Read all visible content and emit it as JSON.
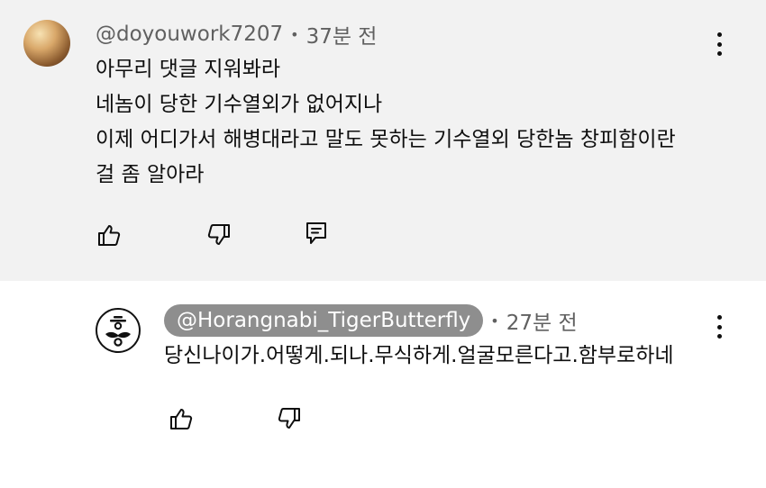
{
  "comment": {
    "author": "@doyouwork7207",
    "time": "37분 전",
    "lines": [
      "아무리 댓글 지워봐라",
      "네놈이 당한 기수열외가 없어지나",
      "이제 어디가서 해병대라고 말도 못하는 기수열외 당한놈 창피함이란",
      "걸 좀 알아라"
    ],
    "icons": [
      "like-icon",
      "dislike-icon",
      "reply-icon",
      "more-options-icon"
    ]
  },
  "reply": {
    "author": "@Horangnabi_TigerButterfly",
    "time": "27분 전",
    "text": "당신나이가.어떻게.되나.무식하게.얼굴모른다고.함부로하네",
    "icons": [
      "like-icon",
      "dislike-icon",
      "more-options-icon"
    ]
  },
  "separator": "•",
  "colors": {
    "highlight_background": "#f2f2f2",
    "author_pill": "#8e8e8e",
    "secondary_text": "#606060"
  }
}
